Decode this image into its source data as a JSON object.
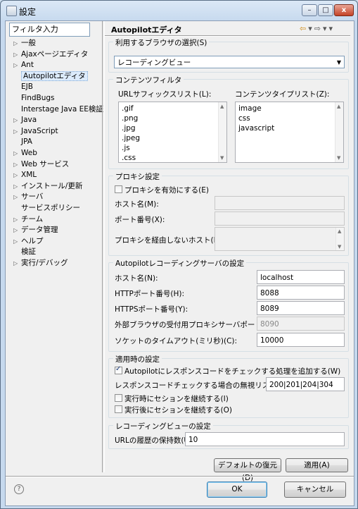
{
  "window": {
    "title": "設定",
    "btn_min": "–",
    "btn_max": "□",
    "btn_close": "x"
  },
  "sidebar": {
    "filter_value": "フィルタ入力",
    "items": [
      {
        "label": "一般",
        "expandable": true
      },
      {
        "label": "Ajaxページエディタ",
        "expandable": true
      },
      {
        "label": "Ant",
        "expandable": true
      },
      {
        "label": "Autopilotエディタ",
        "expandable": false,
        "selected": true
      },
      {
        "label": "EJB",
        "expandable": false
      },
      {
        "label": "FindBugs",
        "expandable": false
      },
      {
        "label": "Interstage Java EE検証",
        "expandable": false
      },
      {
        "label": "Java",
        "expandable": true
      },
      {
        "label": "JavaScript",
        "expandable": true
      },
      {
        "label": "JPA",
        "expandable": false
      },
      {
        "label": "Web",
        "expandable": true
      },
      {
        "label": "Web サービス",
        "expandable": true
      },
      {
        "label": "XML",
        "expandable": true
      },
      {
        "label": "インストール/更新",
        "expandable": true
      },
      {
        "label": "サーバ",
        "expandable": true
      },
      {
        "label": "サービスポリシー",
        "expandable": false
      },
      {
        "label": "チーム",
        "expandable": true
      },
      {
        "label": "データ管理",
        "expandable": true
      },
      {
        "label": "ヘルプ",
        "expandable": true
      },
      {
        "label": "検証",
        "expandable": false
      },
      {
        "label": "実行/デバッグ",
        "expandable": true
      }
    ]
  },
  "page": {
    "title": "Autopilotエディタ",
    "browser": {
      "group_label": "利用するブラウザの選択(S)",
      "selected": "レコーディングビュー"
    },
    "content_filter": {
      "group_label": "コンテンツフィルタ",
      "url_suffix_label": "URLサフィックスリスト(L):",
      "url_suffixes": [
        ".gif",
        ".png",
        ".jpg",
        ".jpeg",
        ".js",
        ".css"
      ],
      "content_type_label": "コンテンツタイプリスト(Z):",
      "content_types": [
        "image",
        "css",
        "javascript"
      ]
    },
    "proxy": {
      "group_label": "プロキシ設定",
      "enable_label": "プロキシを有効にする(E)",
      "host_label": "ホスト名(M):",
      "port_label": "ポート番号(X):",
      "no_proxy_label": "プロキシを経由しないホスト(B):"
    },
    "recording_server": {
      "group_label": "Autopilotレコーディングサーバの設定",
      "host_label": "ホスト名(N):",
      "host_value": "localhost",
      "http_label": "HTTPポート番号(H):",
      "http_value": "8088",
      "https_label": "HTTPSポート番号(Y):",
      "https_value": "8089",
      "ext_proxy_label": "外部ブラウザの受付用プロキシサーバポート(P):",
      "ext_proxy_value": "8090",
      "timeout_label": "ソケットのタイムアウト(ミリ秒)(C):",
      "timeout_value": "10000"
    },
    "apply_settings": {
      "group_label": "適用時の設定",
      "check_response_label": "Autopilotにレスポンスコードをチェックする処理を追加する(W)",
      "ignore_list_label": "レスポンスコードチェックする場合の無視リスト(F)",
      "ignore_list_value": "200|201|204|304",
      "continue_session_run_label": "実行時にセションを継続する(I)",
      "continue_session_after_label": "実行後にセションを継続する(O)"
    },
    "view_settings": {
      "group_label": "レコーディングビューの設定",
      "history_label": "URLの履歴の保持数(U)",
      "history_value": "10"
    },
    "restore_defaults": "デフォルトの復元(D)",
    "apply": "適用(A)"
  },
  "footer": {
    "ok": "OK",
    "cancel": "キャンセル",
    "help_icon": "?"
  }
}
